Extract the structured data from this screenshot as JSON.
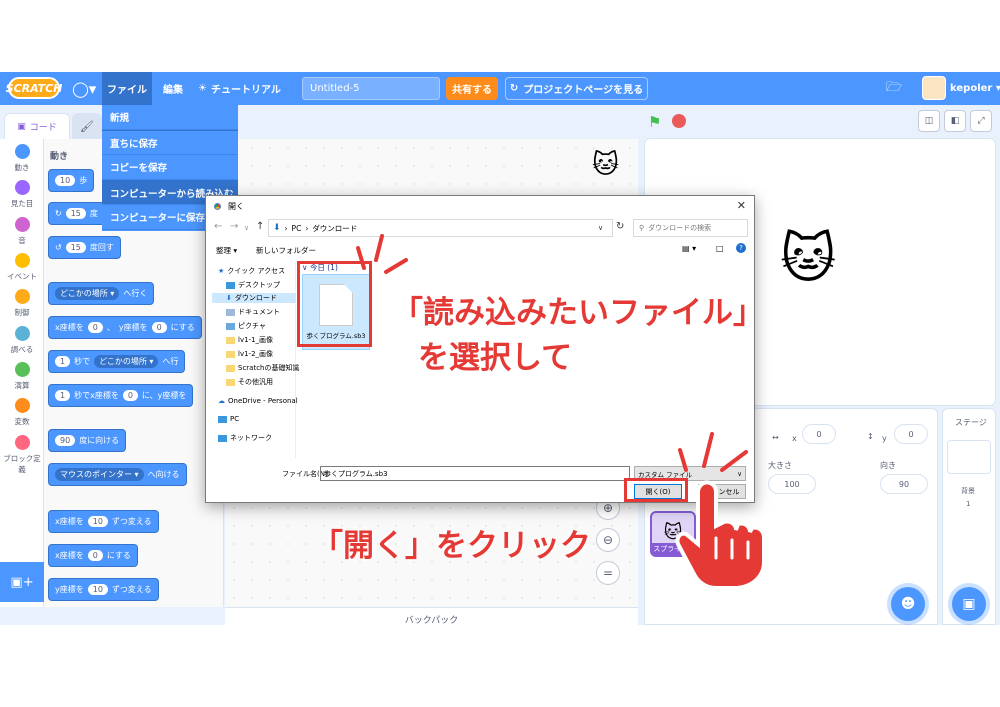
{
  "menubar": {
    "logo": "SCRATCH",
    "file": "ファイル",
    "edit": "編集",
    "tutorial": "チュートリアル",
    "project_title": "Untitled-5",
    "share": "共有する",
    "project_page": "プロジェクトページを見る",
    "user": "kepoler"
  },
  "file_menu": {
    "items": [
      "新規",
      "直ちに保存",
      "コピーを保存",
      "コンピューターから読み込む",
      "コンピューターに保存する"
    ]
  },
  "tabs": {
    "code": "コード"
  },
  "categories": [
    "動き",
    "見た目",
    "音",
    "イベント",
    "制御",
    "調べる",
    "演算",
    "変数",
    "ブロック定義"
  ],
  "category_colors": [
    "#4c97ff",
    "#9966ff",
    "#cf63cf",
    "#ffbf00",
    "#ffab19",
    "#5cb1d6",
    "#59c059",
    "#ff8c1a",
    "#ff6680"
  ],
  "palette": {
    "title": "動き",
    "move_value": "10",
    "turn_right_value": "15",
    "turn_left_value": "15",
    "degrees": "度回す",
    "goto_random": "どこかの場所",
    "goto_suffix": "へ行く",
    "x_label": "x座標を",
    "x_value": "0",
    "y_label": "y座標を",
    "y_value": "0",
    "set_suffix": "にする",
    "glide_value": "1",
    "glide_label": "秒で",
    "glide_target": "どこかの場所",
    "glide_suffix": "へ行",
    "glide2_label": "秒でx座標を",
    "glide2_x": "0",
    "glide2_mid": "に、y座標を",
    "point_value": "90",
    "point_label": "度に向ける",
    "point_toward": "マウスのポインター",
    "point_toward_suffix": "へ向ける",
    "change_x_label": "x座標を",
    "change_x_value": "10",
    "change_suffix": "ずつ変える",
    "set_x_label": "x座標を",
    "set_x_value": "0",
    "change_y_label": "y座標を",
    "change_y_value": "10"
  },
  "backpack": "バックパック",
  "sprite_panel": {
    "x_label": "x",
    "x_value": "0",
    "y_label": "y",
    "y_value": "0",
    "size_label": "大きさ",
    "size_value": "100",
    "direction_label": "向き",
    "direction_value": "90",
    "sprite_name": "スプライト1"
  },
  "stage_panel": {
    "title": "ステージ",
    "backdrop_label": "背景",
    "backdrop_count": "1"
  },
  "dialog": {
    "title": "開く",
    "path_pc": "PC",
    "path_folder": "ダウンロード",
    "search_placeholder": "ダウンロードの検索",
    "organize": "整理",
    "new_folder": "新しいフォルダー",
    "tree": [
      "クイック アクセス",
      "デスクトップ",
      "ダウンロード",
      "ドキュメント",
      "ピクチャ",
      "lv1-1_画像",
      "lv1-2_画像",
      "Scratchの基礎知識",
      "その他汎用",
      "OneDrive - Personal",
      "PC",
      "ネットワーク"
    ],
    "group_header": "今日 (1)",
    "file_name": "歩くプログラム.sb3",
    "filename_label": "ファイル名(N):",
    "filename_value": "歩くプログラム.sb3",
    "filetype": "カスタム ファイル",
    "open_button": "開く(O)",
    "cancel_button": "キャンセル"
  },
  "annotations": {
    "select_file_line1": "「読み込みたいファイル」",
    "select_file_line2": "を選択して",
    "click_open": "「開く」をクリック",
    "color": "#e53935"
  }
}
